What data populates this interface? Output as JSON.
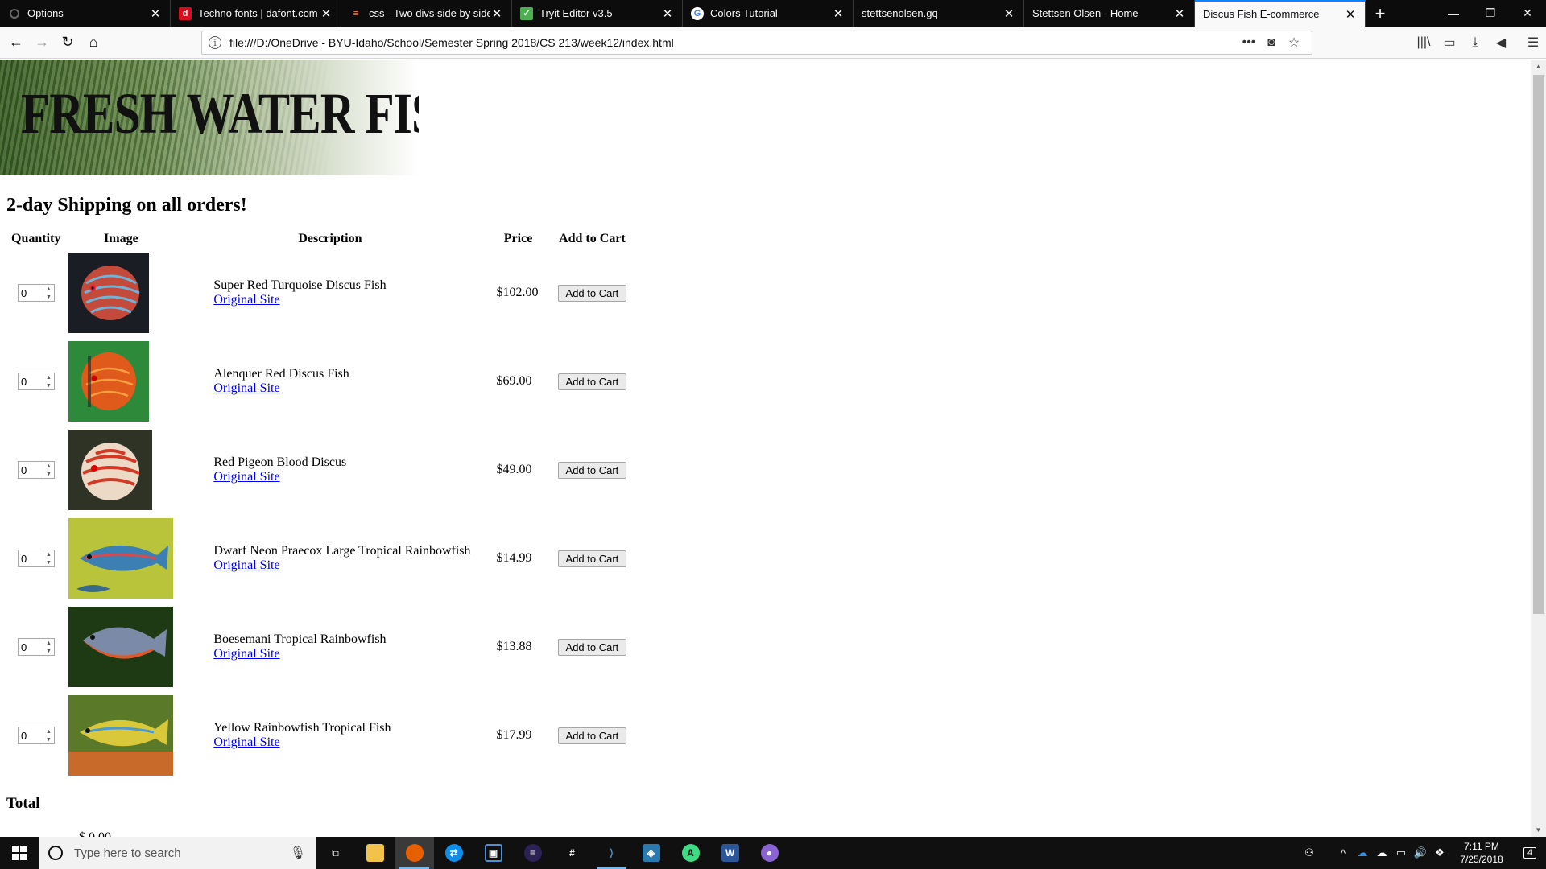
{
  "browser": {
    "tabs": [
      {
        "title": "Options",
        "favicon": "gear-icon",
        "fav_color": "#0c0c0d",
        "fav_text": ""
      },
      {
        "title": "Techno fonts | dafont.com",
        "favicon": "dafont-icon",
        "fav_color": "#d70f1c",
        "fav_text": "d"
      },
      {
        "title": "css - Two divs side by side - F",
        "favicon": "stackoverflow-icon",
        "fav_color": "#f48024",
        "fav_text": "≡"
      },
      {
        "title": "Tryit Editor v3.5",
        "favicon": "w3schools-icon",
        "fav_color": "#4caf50",
        "fav_text": "✓"
      },
      {
        "title": "Colors Tutorial",
        "favicon": "google-icon",
        "fav_color": "#ffffff",
        "fav_text": "G"
      },
      {
        "title": "stettsenolsen.gq",
        "favicon": "",
        "fav_color": "",
        "fav_text": ""
      },
      {
        "title": "Stettsen Olsen - Home",
        "favicon": "",
        "fav_color": "",
        "fav_text": ""
      },
      {
        "title": "Discus Fish E-commerce",
        "favicon": "",
        "fav_color": "",
        "fav_text": ""
      }
    ],
    "url": "file:///D:/OneDrive - BYU-Idaho/School/Semester Spring 2018/CS 213/week12/index.html"
  },
  "page": {
    "banner_title": "FRESH WATER FISH",
    "shipping_text": "2-day Shipping on all orders!",
    "table_headers": {
      "quantity": "Quantity",
      "image": "Image",
      "description": "Description",
      "price": "Price",
      "add_to_cart": "Add to Cart"
    },
    "products": [
      {
        "name": "Super Red Turquoise Discus Fish",
        "link": "Original Site",
        "price": "$102.00",
        "qty": "0",
        "button": "Add to Cart"
      },
      {
        "name": "Alenquer Red Discus Fish",
        "link": "Original Site",
        "price": "$69.00",
        "qty": "0",
        "button": "Add to Cart"
      },
      {
        "name": "Red Pigeon Blood Discus",
        "link": "Original Site",
        "price": "$49.00",
        "qty": "0",
        "button": "Add to Cart"
      },
      {
        "name": "Dwarf Neon Praecox Large Tropical Rainbowfish",
        "link": "Original Site",
        "price": "$14.99",
        "qty": "0",
        "button": "Add to Cart"
      },
      {
        "name": "Boesemani Tropical Rainbowfish",
        "link": "Original Site",
        "price": "$13.88",
        "qty": "0",
        "button": "Add to Cart"
      },
      {
        "name": "Yellow Rainbowfish Tropical Fish",
        "link": "Original Site",
        "price": "$17.99",
        "qty": "0",
        "button": "Add to Cart"
      }
    ],
    "total_label": "Total",
    "total_value": "$ 0.00"
  },
  "taskbar": {
    "search_placeholder": "Type here to search",
    "time": "7:11 PM",
    "date": "7/25/2018",
    "notification_count": "4"
  }
}
